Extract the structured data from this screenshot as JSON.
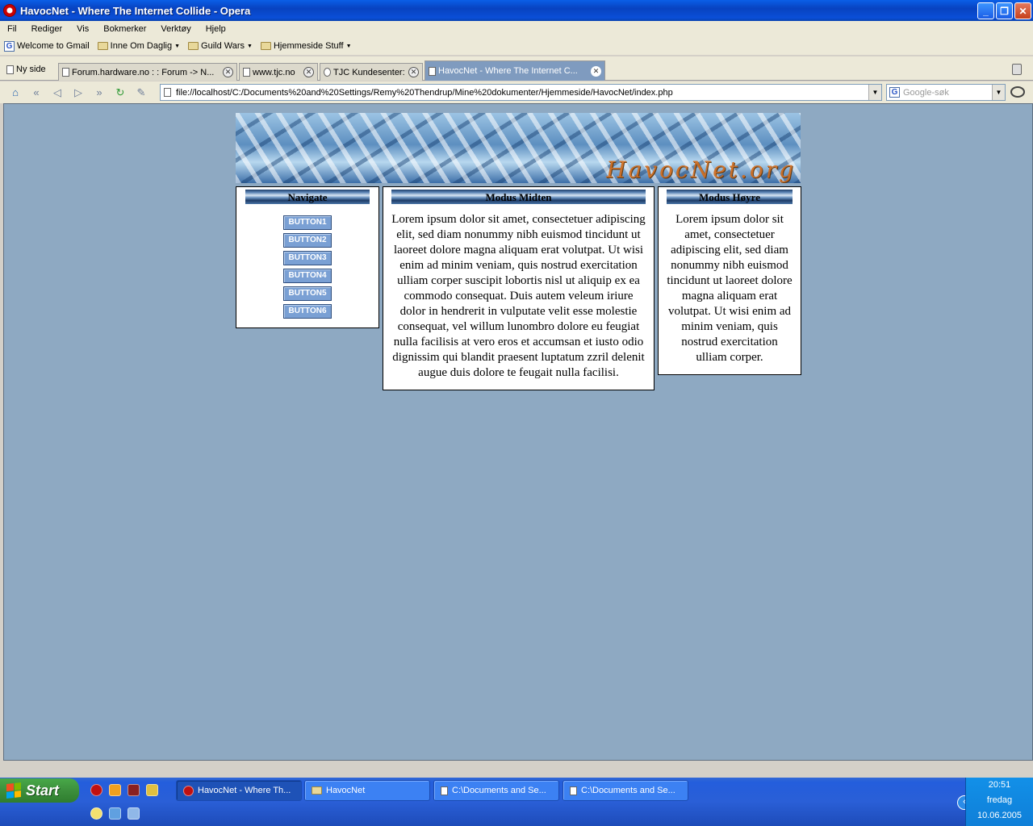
{
  "window": {
    "title": "HavocNet - Where The Internet Collide - Opera",
    "buttons": {
      "minimize": "_",
      "maximize": "❐",
      "close": "✕"
    }
  },
  "menu": [
    "Fil",
    "Rediger",
    "Vis",
    "Bokmerker",
    "Verktøy",
    "Hjelp"
  ],
  "bookmarks": [
    "Welcome to Gmail",
    "Inne Om Daglig",
    "Guild Wars",
    "Hjemmeside Stuff"
  ],
  "tabs": {
    "new_page": "Ny side",
    "items": [
      {
        "label": "Forum.hardware.no : : Forum -> N..."
      },
      {
        "label": "www.tjc.no"
      },
      {
        "label": "TJC Kundesenter:"
      },
      {
        "label": "HavocNet - Where The Internet C..."
      }
    ]
  },
  "address": {
    "url": "file://localhost/C:/Documents%20and%20Settings/Remy%20Thendrup/Mine%20dokumenter/Hjemmeside/HavocNet/index.php",
    "search_placeholder": "Google-søk"
  },
  "page": {
    "logo": "HavocNet.org",
    "nav": {
      "title": "Navigate",
      "buttons": [
        "BUTTON1",
        "BUTTON2",
        "BUTTON3",
        "BUTTON4",
        "BUTTON5",
        "BUTTON6"
      ]
    },
    "middle": {
      "title": "Modus Midten",
      "text": "Lorem ipsum dolor sit amet, consectetuer adipiscing elit, sed diam nonummy nibh euismod tincidunt ut laoreet dolore magna aliquam erat volutpat. Ut wisi enim ad minim veniam, quis nostrud exercitation ulliam corper suscipit lobortis nisl ut aliquip ex ea commodo consequat. Duis autem veleum iriure dolor in hendrerit in vulputate velit esse molestie consequat, vel willum lunombro dolore eu feugiat nulla facilisis at vero eros et accumsan et iusto odio dignissim qui blandit praesent luptatum zzril delenit augue duis dolore te feugait nulla facilisi."
    },
    "right": {
      "title": "Modus Høyre",
      "text": "Lorem ipsum dolor sit amet, consectetuer adipiscing elit, sed diam nonummy nibh euismod tincidunt ut laoreet dolore magna aliquam erat volutpat. Ut wisi enim ad minim veniam, quis nostrud exercitation ulliam corper."
    }
  },
  "taskbar": {
    "start": "Start",
    "tasks": [
      {
        "label": "HavocNet - Where Th..."
      },
      {
        "label": "HavocNet"
      },
      {
        "label": "C:\\Documents and Se..."
      },
      {
        "label": "C:\\Documents and Se..."
      }
    ],
    "clock": {
      "time": "20:51",
      "day": "fredag",
      "date": "10.06.2005"
    }
  },
  "colors": {
    "page_background": "#8ea9c2",
    "button_fill": "#7aa0d4",
    "tab_active": "#7f9bbf",
    "logo_orange": "#d26a18"
  }
}
